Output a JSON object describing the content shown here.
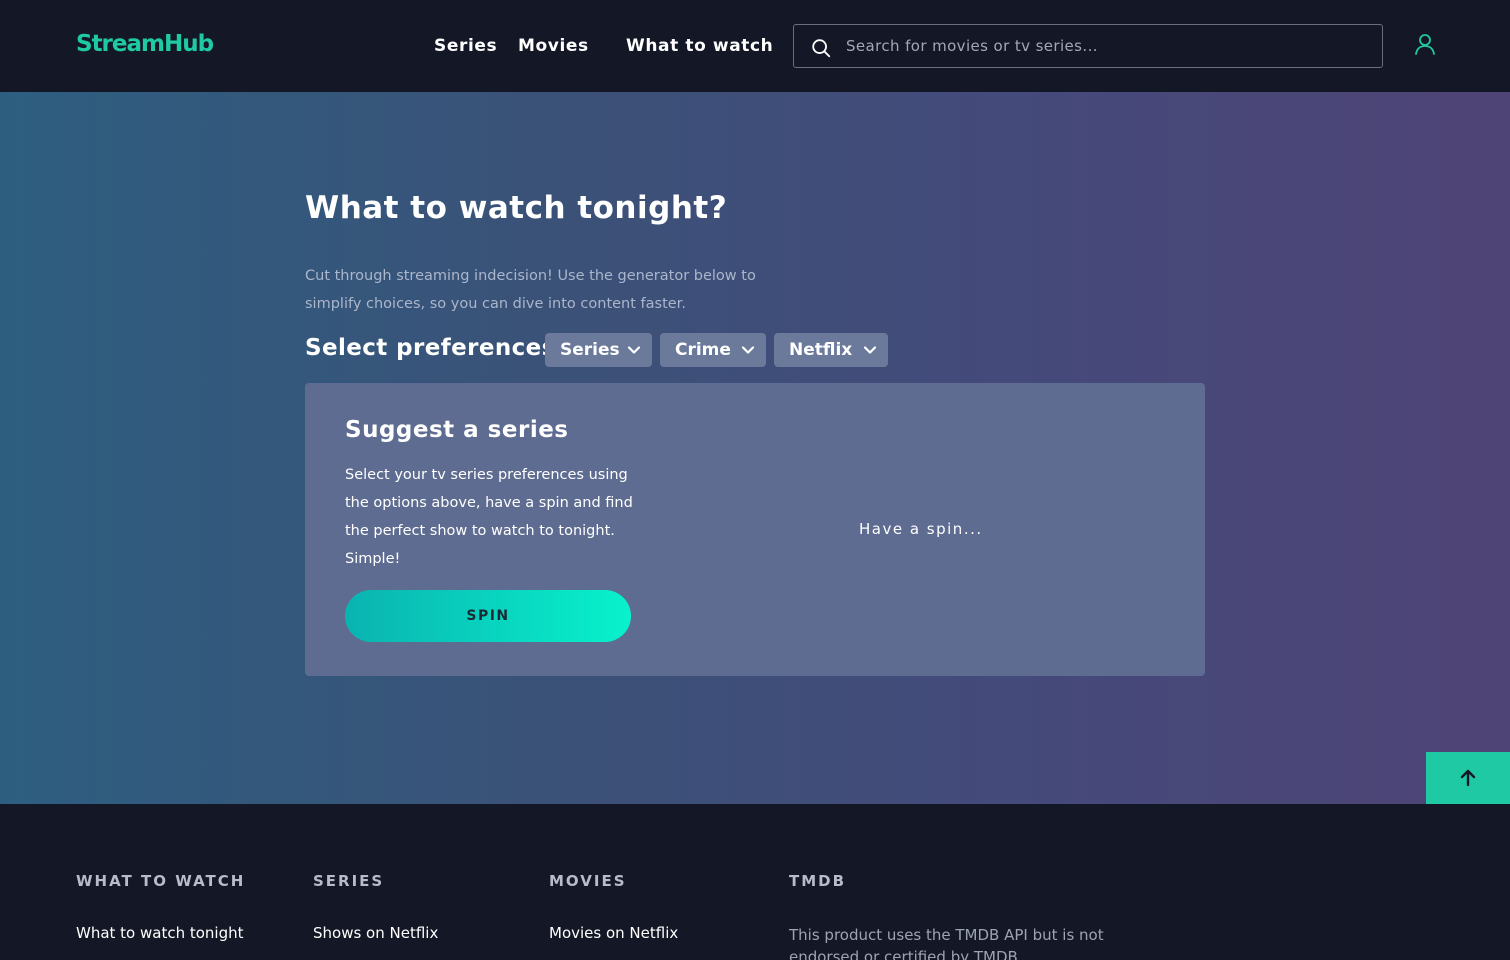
{
  "header": {
    "logo": "StreamHub",
    "nav": [
      "Series",
      "Movies",
      "What to watch"
    ],
    "search": {
      "placeholder": "Search for movies or tv series..."
    }
  },
  "hero": {
    "title": "What to watch tonight?",
    "description": "Cut through streaming indecision! Use the generator below to simplify choices, so you can dive into content faster.",
    "preferences_label": "Select preferences:",
    "selects": [
      "Series",
      "Crime",
      "Netflix"
    ],
    "card": {
      "title": "Suggest a series",
      "description": "Select your tv series preferences using the options above, have a spin and find the perfect show to watch to tonight. Simple!",
      "button": "SPIN",
      "status": "Have a spin..."
    }
  },
  "footer": {
    "columns": [
      {
        "heading": "WHAT TO WATCH",
        "link": "What to watch tonight"
      },
      {
        "heading": "SERIES",
        "link": "Shows on Netflix"
      },
      {
        "heading": "MOVIES",
        "link": "Movies on Netflix"
      },
      {
        "heading": "TMDB",
        "text": "This product uses the TMDB API but is not endorsed or certified by TMDB."
      }
    ]
  },
  "colors": {
    "brand": "#1fc9a3",
    "background": "#141826",
    "card": "#5e6c91",
    "select": "#6b7a9a"
  },
  "icons": [
    "search-icon",
    "user-icon",
    "chevron-down-icon",
    "arrow-up-icon"
  ]
}
